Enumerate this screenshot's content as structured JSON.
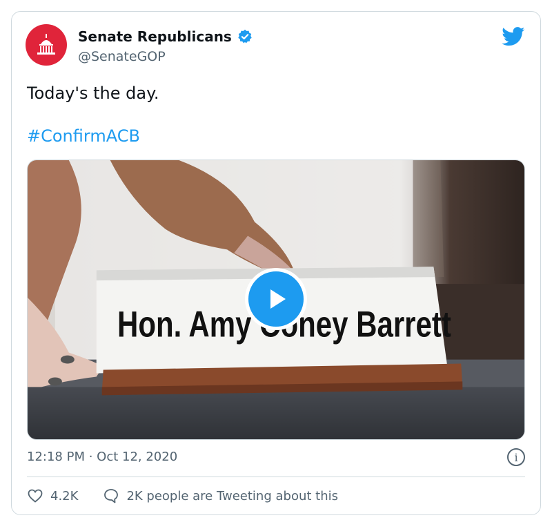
{
  "author": {
    "name": "Senate Republicans",
    "handle": "@SenateGOP",
    "avatar_icon": "capitol-dome-icon",
    "verified_icon": "verified-badge-icon",
    "brand_color": "#e0243a"
  },
  "tweet": {
    "text": "Today's the day.",
    "hashtag": "#ConfirmACB",
    "timestamp": "12:18 PM · Oct 12, 2020"
  },
  "media": {
    "type": "video",
    "nameplate_text": "Hon. Amy Coney Barrett",
    "play_icon": "play-icon"
  },
  "actions": {
    "likes": "4.2K",
    "replies_label": "2K people are Tweeting about this"
  },
  "icons": {
    "platform": "twitter-bird-icon",
    "info": "info-icon",
    "like": "heart-icon",
    "reply": "speech-bubble-icon"
  },
  "colors": {
    "link": "#1d9bf0",
    "secondary_text": "#536471",
    "border": "#cfd9de"
  }
}
